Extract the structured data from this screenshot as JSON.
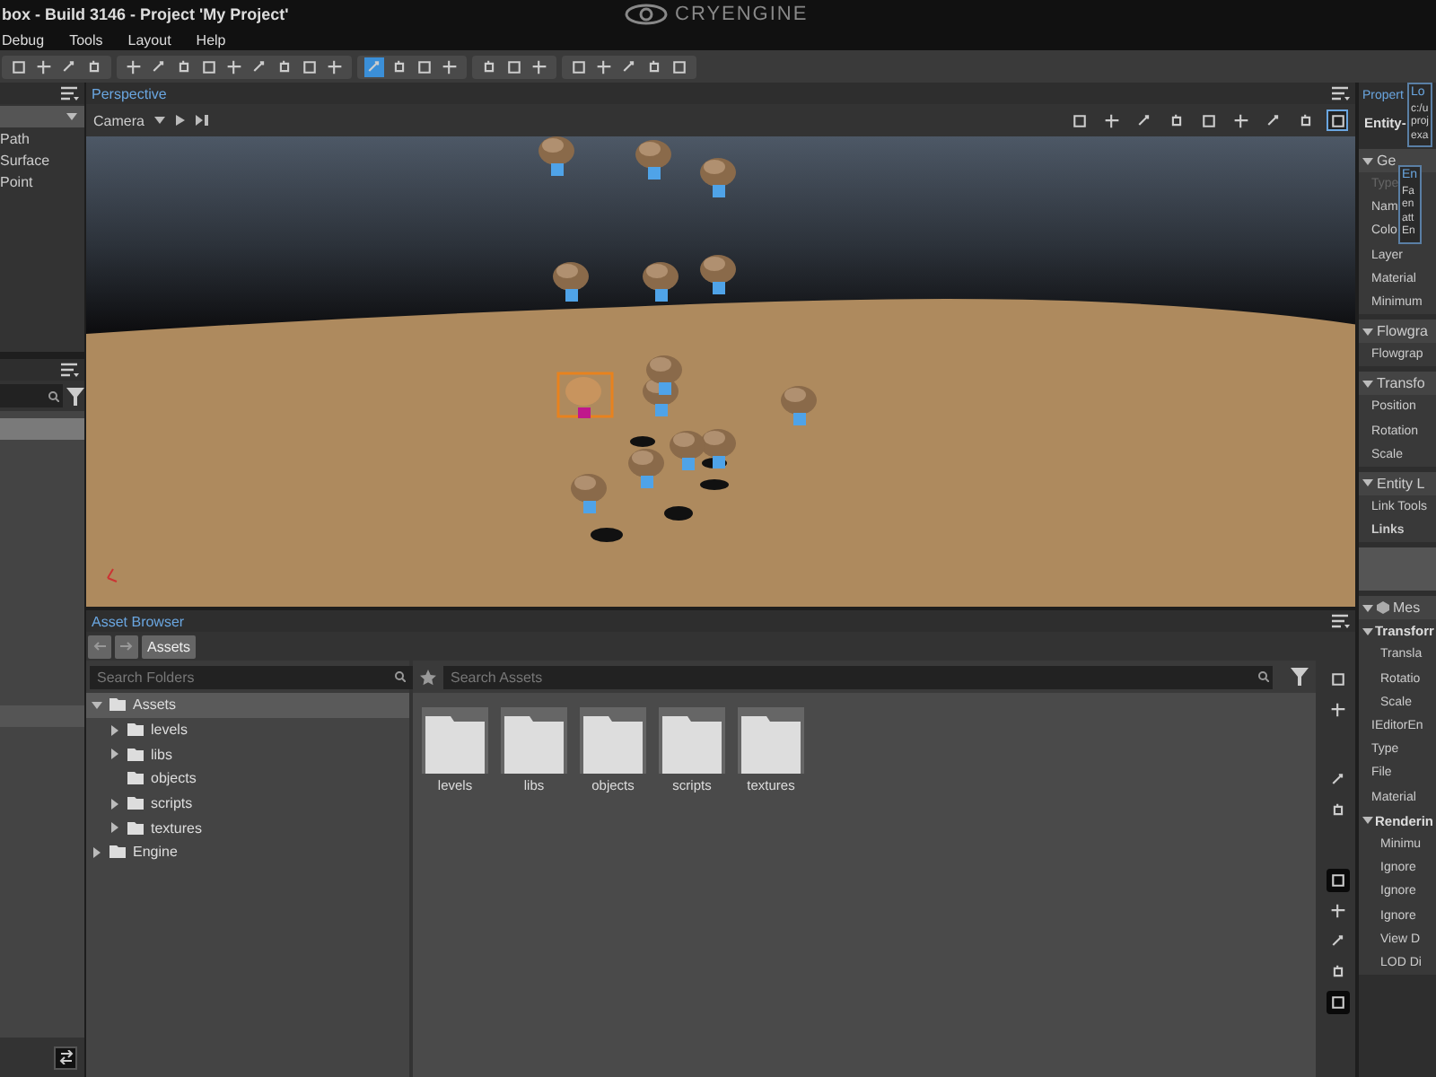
{
  "window": {
    "title": "box - Build 3146 - Project 'My Project'",
    "logo": "CRYENGINE"
  },
  "menu": [
    "Debug",
    "Tools",
    "Layout",
    "Help"
  ],
  "toolbar": [
    [
      {
        "selected": false
      },
      {
        "selected": false
      },
      {
        "selected": false
      },
      {
        "selected": false
      }
    ],
    [
      {
        "selected": false
      },
      {
        "selected": false
      },
      {
        "selected": false
      },
      {
        "selected": false
      },
      {
        "selected": false
      },
      {
        "selected": false
      },
      {
        "selected": false
      },
      {
        "selected": false
      },
      {
        "selected": false
      }
    ],
    [
      {
        "selected": true
      },
      {
        "selected": false
      },
      {
        "selected": false
      },
      {
        "selected": false
      }
    ],
    [
      {
        "selected": false
      },
      {
        "selected": false
      },
      {
        "selected": false
      }
    ],
    [
      {
        "selected": false
      },
      {
        "selected": false
      },
      {
        "selected": false
      },
      {
        "selected": false
      },
      {
        "selected": false
      }
    ]
  ],
  "left_panel": {
    "items": [
      "Path",
      "Surface",
      "Point"
    ],
    "rows": [
      {
        "selected": true
      },
      {
        "selected": false
      }
    ]
  },
  "viewport": {
    "title": "Perspective",
    "camera": "Camera",
    "tools": [
      {
        "selected": false
      },
      {
        "selected": false
      },
      {
        "selected": false
      },
      {
        "selected": false
      },
      {
        "selected": false
      },
      {
        "selected": false
      },
      {
        "selected": false
      },
      {
        "selected": false
      },
      {
        "selected": true
      }
    ]
  },
  "asset_browser": {
    "title": "Asset Browser",
    "breadcrumb": "Assets",
    "folder_search": {
      "placeholder": "Search Folders"
    },
    "asset_search": {
      "placeholder": "Search Assets"
    },
    "tree": [
      {
        "label": "Assets",
        "expanded": true,
        "selected": true,
        "children": [
          {
            "label": "levels",
            "expandable": true,
            "expanded": false,
            "selected": false
          },
          {
            "label": "libs",
            "expandable": true,
            "expanded": false,
            "selected": false
          },
          {
            "label": "objects",
            "expandable": false,
            "selected": false
          },
          {
            "label": "scripts",
            "expandable": true,
            "expanded": false,
            "selected": false
          },
          {
            "label": "textures",
            "expandable": true,
            "expanded": false,
            "selected": false
          }
        ],
        "expandable": true
      },
      {
        "label": "Engine",
        "expandable": true,
        "expanded": false,
        "selected": false
      }
    ],
    "files": [
      "levels",
      "libs",
      "objects",
      "scripts",
      "textures"
    ],
    "side_tools": [
      {
        "selected": false
      },
      {
        "selected": false
      },
      {
        "selected": false
      },
      {
        "selected": false
      },
      {
        "selected": true
      },
      {
        "selected": false
      },
      {
        "selected": false
      },
      {
        "selected": false
      },
      {
        "selected": true
      }
    ]
  },
  "properties": {
    "title": "Propert",
    "entity": "Entity-",
    "items": [
      {
        "kind": "header",
        "label": "Ge"
      },
      {
        "kind": "row",
        "label": "Type",
        "disabled": true
      },
      {
        "kind": "row",
        "label": "Nam",
        "disabled": false
      },
      {
        "kind": "row",
        "label": "Colo",
        "disabled": false
      },
      {
        "kind": "row",
        "label": "Layer",
        "disabled": false
      },
      {
        "kind": "row",
        "label": "Material",
        "disabled": false
      },
      {
        "kind": "row",
        "label": "Minimum",
        "disabled": false
      },
      {
        "kind": "header",
        "label": "Flowgra"
      },
      {
        "kind": "row",
        "label": "Flowgrap",
        "disabled": false
      },
      {
        "kind": "header",
        "label": "Transfo"
      },
      {
        "kind": "row",
        "label": "Position",
        "disabled": false
      },
      {
        "kind": "row",
        "label": "Rotation",
        "disabled": false
      },
      {
        "kind": "row",
        "label": "Scale",
        "disabled": false
      },
      {
        "kind": "header",
        "label": "Entity L"
      },
      {
        "kind": "row",
        "label": "Link Tools",
        "disabled": false
      },
      {
        "kind": "bold",
        "label": "Links"
      },
      {
        "kind": "blank"
      },
      {
        "kind": "cube_header",
        "label": "Mes"
      },
      {
        "kind": "group",
        "label": "Transforr"
      },
      {
        "kind": "indent",
        "label": "Transla"
      },
      {
        "kind": "indent",
        "label": "Rotatio"
      },
      {
        "kind": "indent",
        "label": "Scale"
      },
      {
        "kind": "row",
        "label": "IEditorEn",
        "disabled": false
      },
      {
        "kind": "row",
        "label": "Type",
        "disabled": false
      },
      {
        "kind": "row",
        "label": "File",
        "disabled": false
      },
      {
        "kind": "row",
        "label": "Material",
        "disabled": false
      },
      {
        "kind": "group",
        "label": "Renderin"
      },
      {
        "kind": "indent",
        "label": "Minimu"
      },
      {
        "kind": "indent",
        "label": "Ignore"
      },
      {
        "kind": "indent",
        "label": "Ignore"
      },
      {
        "kind": "indent",
        "label": "Ignore"
      },
      {
        "kind": "indent",
        "label": "View D"
      },
      {
        "kind": "indent",
        "label": "LOD Di"
      }
    ],
    "tooltips": [
      {
        "title": "Lo",
        "lines": [
          "c:/u",
          "proj",
          "exa"
        ]
      },
      {
        "title": "En",
        "lines": [
          "Fa",
          "en",
          "att",
          "En"
        ]
      }
    ]
  }
}
